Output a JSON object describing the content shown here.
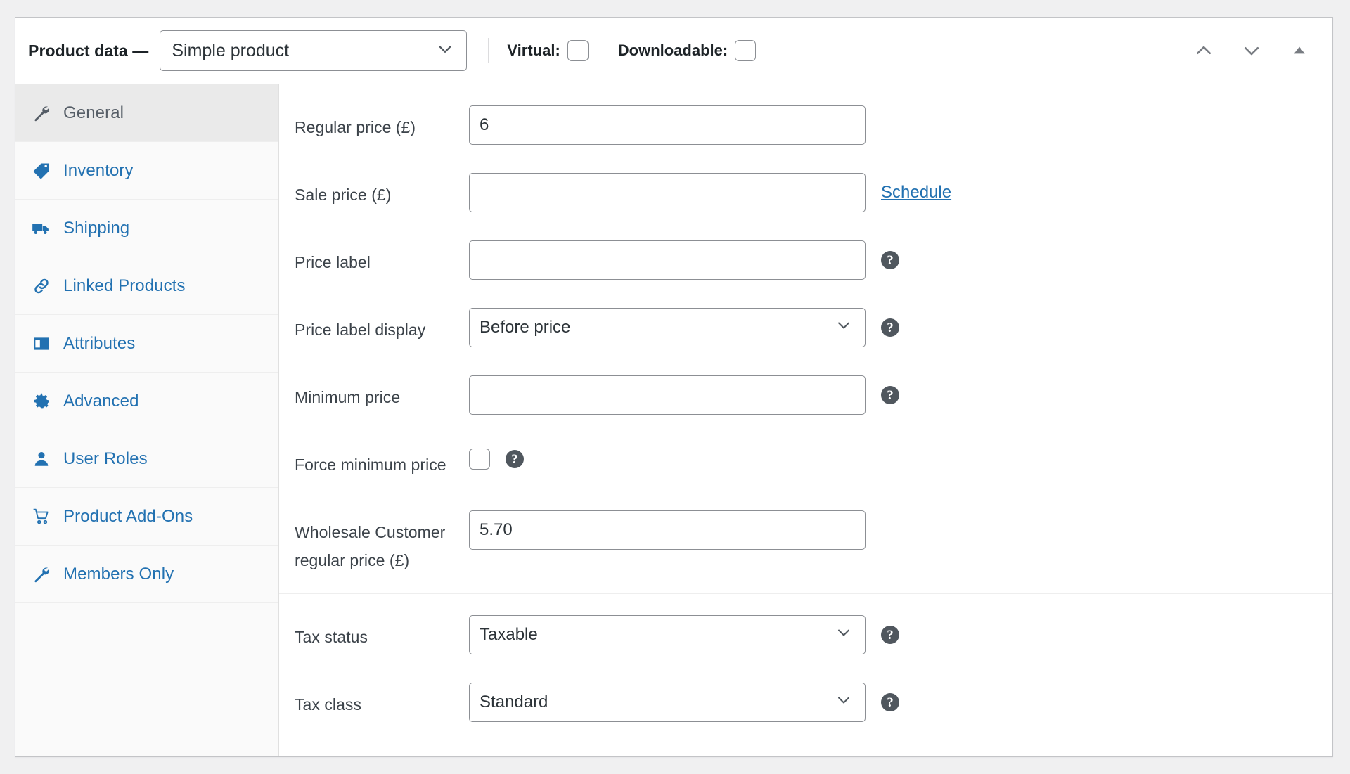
{
  "panel": {
    "title": "Product data —",
    "product_type": {
      "value": "Simple product",
      "icon": "chevron-down-icon"
    },
    "toggles": [
      {
        "label": "Virtual:",
        "checked": false,
        "name": "virtual"
      },
      {
        "label": "Downloadable:",
        "checked": false,
        "name": "downloadable"
      }
    ],
    "actions": [
      {
        "name": "move-up-icon",
        "glyph": "chevron-up"
      },
      {
        "name": "move-down-icon",
        "glyph": "chevron-down"
      },
      {
        "name": "toggle-panel-icon",
        "glyph": "triangle-up"
      }
    ]
  },
  "tabs": [
    {
      "label": "General",
      "icon": "wrench-icon",
      "active": true
    },
    {
      "label": "Inventory",
      "icon": "tag-icon",
      "active": false
    },
    {
      "label": "Shipping",
      "icon": "truck-icon",
      "active": false
    },
    {
      "label": "Linked Products",
      "icon": "link-icon",
      "active": false
    },
    {
      "label": "Attributes",
      "icon": "form-icon",
      "active": false
    },
    {
      "label": "Advanced",
      "icon": "gear-icon",
      "active": false
    },
    {
      "label": "User Roles",
      "icon": "user-icon",
      "active": false
    },
    {
      "label": "Product Add-Ons",
      "icon": "cart-icon",
      "active": false
    },
    {
      "label": "Members Only",
      "icon": "wrench-icon",
      "active": false
    }
  ],
  "groups": [
    {
      "name": "pricing",
      "rows": [
        {
          "name": "regular-price",
          "label": "Regular price (£)",
          "control": "text",
          "value": "6",
          "placeholder": "",
          "help": false,
          "link": null
        },
        {
          "name": "sale-price",
          "label": "Sale price (£)",
          "control": "text",
          "value": "",
          "placeholder": "",
          "help": false,
          "link": "Schedule"
        },
        {
          "name": "price-label",
          "label": "Price label",
          "control": "text",
          "value": "",
          "placeholder": "",
          "help": true,
          "link": null
        },
        {
          "name": "price-label-display",
          "label": "Price label display",
          "control": "select",
          "value": "Before price",
          "help": true,
          "link": null
        },
        {
          "name": "minimum-price",
          "label": "Minimum price",
          "control": "text",
          "value": "",
          "placeholder": "",
          "help": true,
          "link": null
        },
        {
          "name": "force-minimum-price",
          "label": "Force minimum price",
          "control": "checkbox",
          "checked": false,
          "help": true,
          "link": null
        },
        {
          "name": "wholesale-customer-regular-price",
          "label": "Wholesale Customer regular price (£)",
          "control": "text",
          "value": "5.70",
          "placeholder": "",
          "help": false,
          "link": null
        }
      ]
    },
    {
      "name": "tax",
      "rows": [
        {
          "name": "tax-status",
          "label": "Tax status",
          "control": "select",
          "value": "Taxable",
          "help": true,
          "link": null
        },
        {
          "name": "tax-class",
          "label": "Tax class",
          "control": "select",
          "value": "Standard",
          "help": true,
          "link": null
        }
      ]
    }
  ],
  "colors": {
    "link": "#2271b1",
    "text": "#3c434a",
    "border": "#8c8f94",
    "panel_bg": "#ffffff",
    "page_bg": "#f0f0f1",
    "sidebar_bg": "#fafafa",
    "active_tab_bg": "#eaeaea",
    "help_bg": "#50575e"
  },
  "help_glyph": "?"
}
